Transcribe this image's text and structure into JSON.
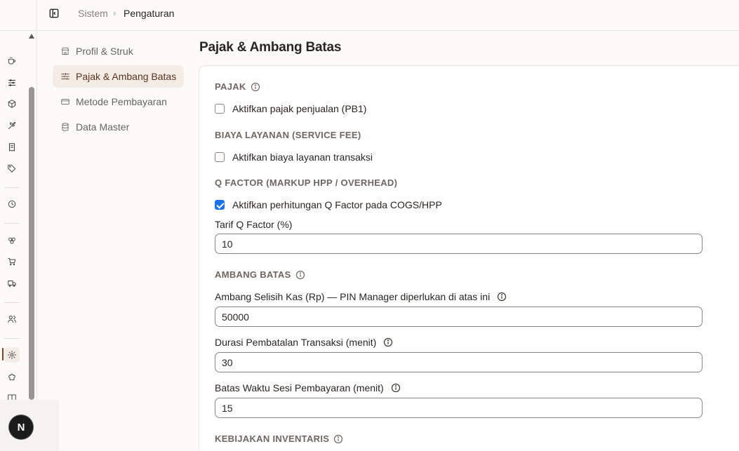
{
  "breadcrumb": {
    "parent": "Sistem",
    "separator": "›",
    "current": "Pengaturan"
  },
  "user": {
    "avatar_initial": "N"
  },
  "subnav": [
    {
      "label": "Profil & Struk",
      "icon": "store-icon"
    },
    {
      "label": "Pajak & Ambang Batas",
      "icon": "sliders-icon"
    },
    {
      "label": "Metode Pembayaran",
      "icon": "credit-card-icon"
    },
    {
      "label": "Data Master",
      "icon": "database-icon"
    }
  ],
  "rail_icons": [
    "coffee-icon",
    "sliders-icon",
    "package-icon",
    "wheat-icon",
    "receipt-icon",
    "tag-icon",
    "clock-icon",
    "cookie-icon",
    "cart-icon",
    "truck-icon",
    "users-icon",
    "gear-icon",
    "chef-hat-icon",
    "book-icon"
  ],
  "main": {
    "title": "Pajak & Ambang Batas",
    "tax": {
      "heading": "PAJAK",
      "checkbox_label": "Aktifkan pajak penjualan (PB1)",
      "checked": false
    },
    "service_fee": {
      "heading": "BIAYA LAYANAN (SERVICE FEE)",
      "checkbox_label": "Aktifkan biaya layanan transaksi",
      "checked": false
    },
    "q_factor": {
      "heading": "Q FACTOR (MARKUP HPP / OVERHEAD)",
      "checkbox_label": "Aktifkan perhitungan Q Factor pada COGS/HPP",
      "checked": true,
      "rate_label": "Tarif Q Factor (%)",
      "rate_value": "10"
    },
    "thresholds": {
      "heading": "AMBANG BATAS",
      "cash_diff_label": "Ambang Selisih Kas (Rp) — PIN Manager diperlukan di atas ini",
      "cash_diff_value": "50000",
      "cancel_duration_label": "Durasi Pembatalan Transaksi (menit)",
      "cancel_duration_value": "30",
      "payment_session_label": "Batas Waktu Sesi Pembayaran (menit)",
      "payment_session_value": "15"
    },
    "inventory": {
      "heading": "KEBIJAKAN INVENTARIS"
    }
  },
  "colors": {
    "accent": "#8a3d22",
    "active_bg": "#f5ece6",
    "checkbox_checked": "#1a73e8"
  }
}
